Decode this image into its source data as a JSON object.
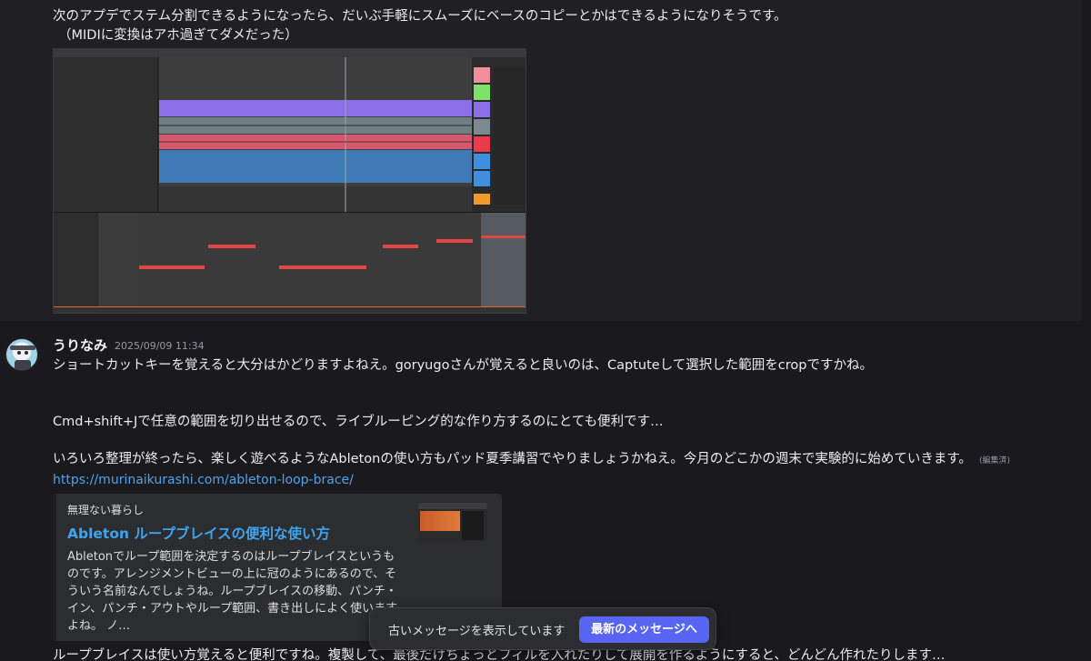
{
  "previous_message": {
    "line1": "次のアプデでステム分割できるようになったら、だいぶ手軽にスムーズにベースのコピーとかはできるようになりそうです。",
    "line2": "（MIDIに変換はアホ過ぎてダメだった）",
    "attachment_icon": "ableton-live-screenshot"
  },
  "message": {
    "username": "うりなみ",
    "timestamp": "2025/09/09 11:34",
    "avatar_icon": "robot-avatar-icon",
    "paragraph1": "ショートカットキーを覚えると大分はかどりますよねえ。goryugoさんが覚えると良いのは、Captuteして選択した範囲をcropですかね。",
    "paragraph2": "Cmd+shift+Jで任意の範囲を切り出せるので、ライブルーピング的な作り方するのにとても便利です…",
    "paragraph3": "いろいろ整理が終ったら、楽しく遊べるようなAbletonの使い方もパッド夏季講習でやりましょうかねえ。今月のどこかの週末で実験的に始めていきます。",
    "edited_label": "(編集済)",
    "link": "https://murinaikurashi.com/ableton-loop-brace/",
    "embed": {
      "site_name": "無理ない暮らし",
      "title": "Ableton ループブレイスの便利な使い方",
      "description": "Abletonでループ範囲を決定するのはループブレイスというも\nのです。アレンジメントビューの上に冠のようにあるので、そ\nういう名前なんでしょうね。ループブレイスの移動、パンチ・\nイン、パンチ・アウトやループ範囲、書き出しによく使います\nよね。 ノ…"
    }
  },
  "next_message": {
    "text": "ループブレイスは使い方覚えると便利ですね。複製して、最後だけちょっとフィルを入れたりして展開を作るようにすると、どんどん作れたりします…"
  },
  "jump_bar": {
    "label": "古いメッセージを表示しています",
    "button": "最新のメッセージへ"
  },
  "colors": {
    "background": "#1a1a1e",
    "link": "#4fa3ea",
    "accent_button": "#5865f2",
    "embed_bg": "#2b2d31"
  }
}
